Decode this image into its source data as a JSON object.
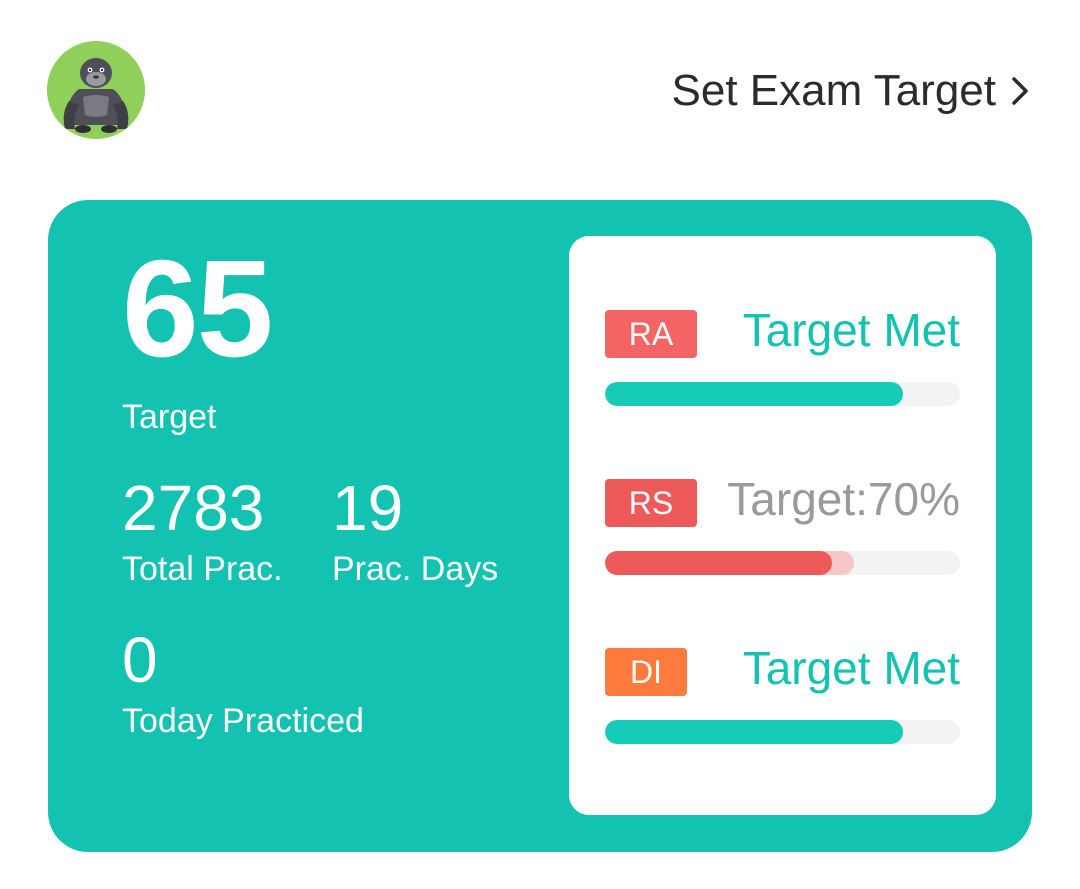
{
  "header": {
    "avatar_icon": "gorilla-avatar-icon",
    "exam_target_label": "Set Exam Target",
    "chevron_icon": "chevron-right-icon"
  },
  "stats": {
    "target_score": "65",
    "target_label": "Target",
    "total_prac_value": "2783",
    "total_prac_label": "Total Prac.",
    "prac_days_value": "19",
    "prac_days_label": "Prac. Days",
    "today_value": "0",
    "today_label": "Today Practiced"
  },
  "sections": [
    {
      "badge": "RA",
      "badge_color": "#f46464",
      "status": "Target Met",
      "met": true,
      "progress": 0.84
    },
    {
      "badge": "RS",
      "badge_color": "#ee5a5a",
      "status": "Target:70%",
      "met": false,
      "progress": 0.64,
      "target": 0.7
    },
    {
      "badge": "DI",
      "badge_color": "#ff7a3d",
      "status": "Target Met",
      "met": true,
      "progress": 0.84
    }
  ],
  "colors": {
    "accent": "#14c2b1",
    "met_bar": "#17cbb9",
    "pending_bar": "#ee5a5a",
    "pending_target": "#f6c7c7",
    "track": "#f2f3f5"
  }
}
